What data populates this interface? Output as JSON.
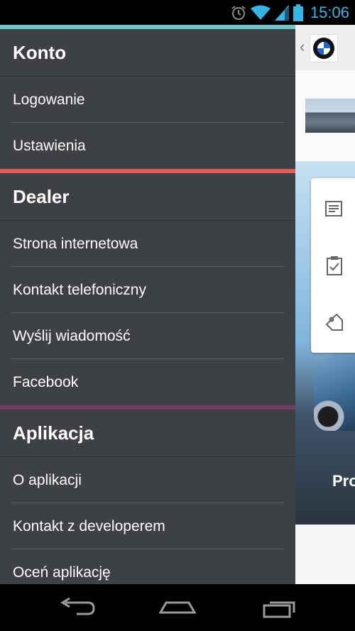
{
  "status_bar": {
    "time": "15:06",
    "icons": [
      "alarm-icon",
      "wifi-icon",
      "cell-signal-icon",
      "battery-icon"
    ]
  },
  "underlay": {
    "caption": "Pro",
    "card_icons": [
      "news-icon",
      "checklist-icon",
      "tag-icon"
    ]
  },
  "drawer": {
    "sections": [
      {
        "title": "Konto",
        "color": "#6ec6c6",
        "items": [
          "Logowanie",
          "Ustawienia"
        ]
      },
      {
        "title": "Dealer",
        "color": "#e35b5b",
        "items": [
          "Strona internetowa",
          "Kontakt telefoniczny",
          "Wyślij wiadomość",
          "Facebook"
        ]
      },
      {
        "title": "Aplikacja",
        "color": "#7a3a62",
        "items": [
          "O aplikacji",
          "Kontakt z developerem",
          "Oceń aplikację"
        ]
      }
    ]
  },
  "nav": {
    "icons": [
      "back-icon",
      "home-icon",
      "recent-apps-icon"
    ]
  }
}
